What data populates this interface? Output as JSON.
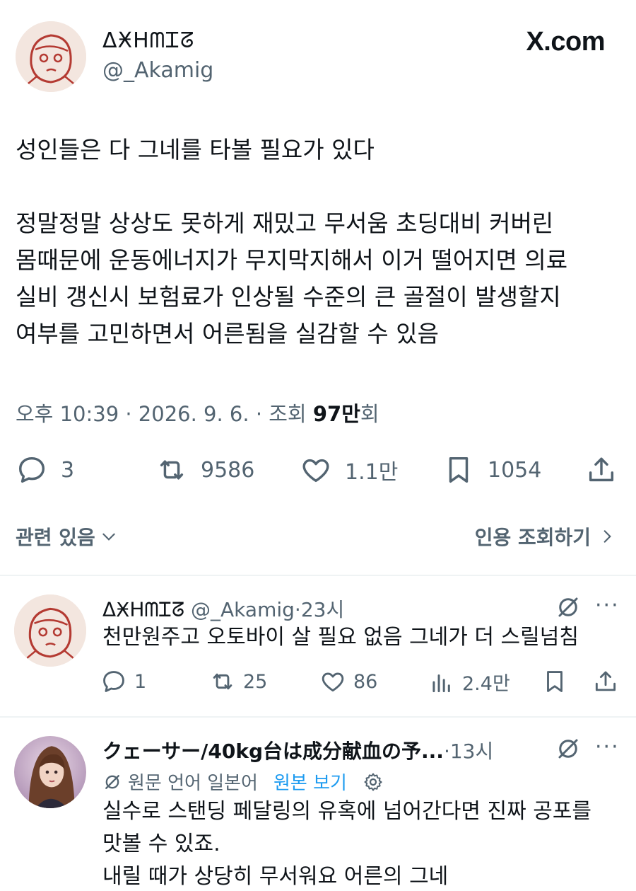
{
  "header": {
    "display_name": "ᐃӾᕼᗰᏆᘔ",
    "handle": "@_Akamig",
    "site": "X.com"
  },
  "tweet": {
    "line1": "성인들은 다 그네를 타볼 필요가 있다",
    "para2": [
      "정말정말 상상도 못하게 재밌고 무서움 초딩대비 커버린",
      "몸때문에 운동에너지가 무지막지해서 이거 떨어지면 의료",
      "실비 갱신시 보험료가 인상될 수준의 큰 골절이 발생할지",
      "여부를 고민하면서 어른됨을 실감할 수 있음"
    ],
    "meta_prefix": "오후 10:39 · 2026. 9. 6. · 조회 ",
    "views": "97만",
    "views_suffix": "회",
    "replies": "3",
    "retweets": "9586",
    "likes": "1.1만",
    "bookmarks": "1054"
  },
  "related": {
    "related_label": "관련 있음",
    "quotes_label": "인용 조회하기"
  },
  "reply1": {
    "display_name": "ᐃӾᕼᗰᏆᘔ",
    "handle": "@_Akamig",
    "time": "23시",
    "text": "천만원주고 오토바이 살 필요 없음 그네가 더 스릴넘침",
    "replies": "1",
    "retweets": "25",
    "likes": "86",
    "views": "2.4만"
  },
  "reply2": {
    "display_name": "クェーサー/40kg台は成分献血の予...",
    "time": "13시",
    "translate_label": "원문 언어 일본어",
    "show_original": "원본 보기",
    "text_lines": [
      "실수로 스탠딩 페달링의 유혹에 넘어간다면 진짜 공포를",
      "맛볼 수 있죠.",
      "내릴 때가 상당히 무서워요 어른의 그네"
    ]
  },
  "colors": {
    "text": "#0f1419",
    "secondary": "#536471",
    "link": "#1d9bf0",
    "divider": "#eff3f4"
  }
}
